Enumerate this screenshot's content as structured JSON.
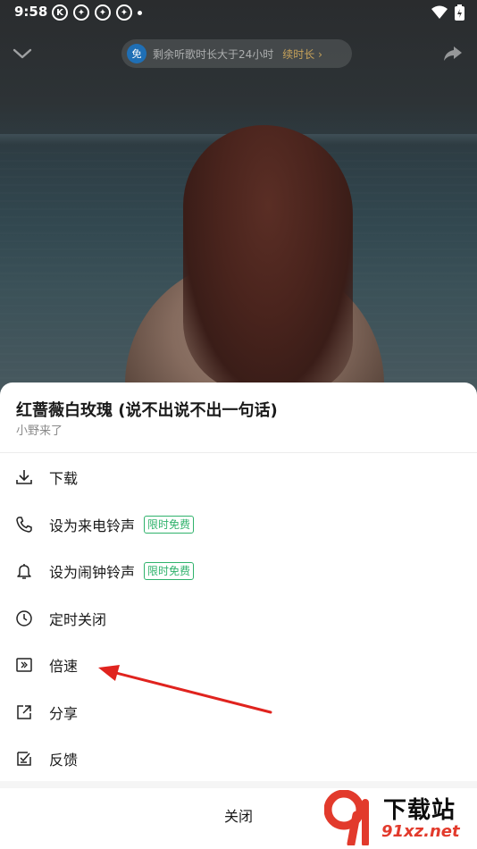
{
  "status_bar": {
    "time": "9:58",
    "notif_icons": [
      "K",
      "",
      "",
      ""
    ]
  },
  "top_bar": {
    "free_badge": "免",
    "promo_text": "剩余听歌时长大于24小时",
    "renew_label": "续时长",
    "renew_chevron": "›"
  },
  "sheet": {
    "song_title": "红蔷薇白玫瑰 (说不出说不出一句话)",
    "artist": "小野来了",
    "items": [
      {
        "label": "下载",
        "icon": "download-icon",
        "badge": ""
      },
      {
        "label": "设为来电铃声",
        "icon": "phone-icon",
        "badge": "限时免费"
      },
      {
        "label": "设为闹钟铃声",
        "icon": "bell-icon",
        "badge": "限时免费"
      },
      {
        "label": "定时关闭",
        "icon": "clock-icon",
        "badge": ""
      },
      {
        "label": "倍速",
        "icon": "speed-icon",
        "badge": ""
      },
      {
        "label": "分享",
        "icon": "share-icon",
        "badge": ""
      },
      {
        "label": "反馈",
        "icon": "feedback-icon",
        "badge": ""
      }
    ],
    "close_label": "关闭"
  },
  "watermark": {
    "logo_text": "下载站",
    "url": "91xz.net"
  },
  "colors": {
    "badge_green": "#2fb26b",
    "renew_gold": "#c7a25a",
    "arrow_red": "#e0231e"
  }
}
